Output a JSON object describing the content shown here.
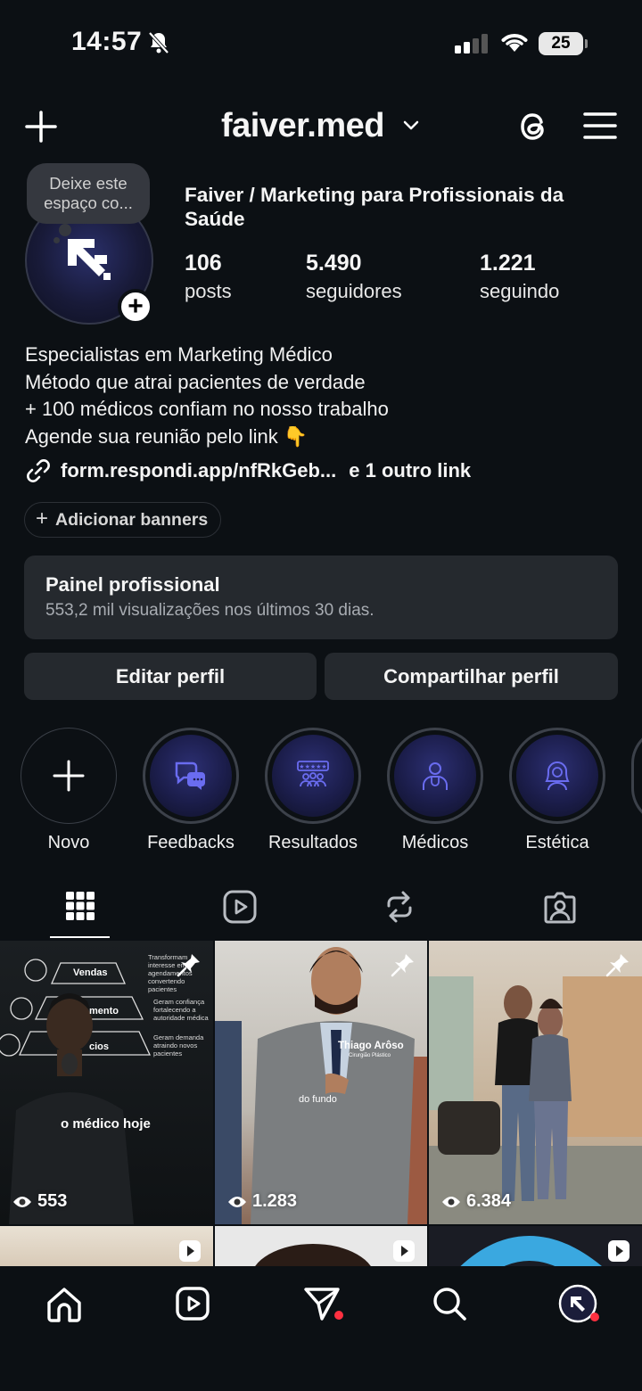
{
  "status_bar": {
    "time": "14:57",
    "battery": "25",
    "icons": [
      "bell-slash-icon",
      "signal-icon",
      "wifi-icon",
      "battery-icon"
    ]
  },
  "header": {
    "username": "faiver.med",
    "icons": [
      "plus-icon",
      "chevron-down-icon",
      "threads-icon",
      "menu-icon"
    ]
  },
  "profile": {
    "note": "Deixe este espaço co...",
    "full_name": "Faiver / Marketing para Profissionais da Saúde",
    "stats": [
      {
        "value": "106",
        "label": "posts"
      },
      {
        "value": "5.490",
        "label": "seguidores"
      },
      {
        "value": "1.221",
        "label": "seguindo"
      }
    ],
    "bio": [
      "Especialistas em Marketing Médico",
      "Método que atrai pacientes de verdade",
      "+ 100 médicos confiam no nosso trabalho",
      "Agende sua reunião pelo link 👇"
    ],
    "link": "form.respondi.app/nfRkGeb...",
    "more_links": "e 1 outro link"
  },
  "banners_label": "Adicionar banners",
  "dashboard": {
    "title": "Painel profissional",
    "subtitle": "553,2 mil visualizações nos últimos 30 dias."
  },
  "buttons": {
    "edit": "Editar perfil",
    "share": "Compartilhar perfil"
  },
  "highlights": [
    {
      "label": "Novo",
      "icon": "plus-icon"
    },
    {
      "label": "Feedbacks",
      "icon": "chat-bubbles-icon"
    },
    {
      "label": "Resultados",
      "icon": "rating-people-icon"
    },
    {
      "label": "Médicos",
      "icon": "doctor-icon"
    },
    {
      "label": "Estética",
      "icon": "woman-face-icon"
    }
  ],
  "tabs": [
    "grid-icon",
    "reels-icon",
    "reposts-icon",
    "tagged-icon"
  ],
  "posts": [
    {
      "views": "553",
      "caption": "o médico hoje",
      "pinned": true,
      "diagram": [
        "Vendas",
        "mento",
        "cios"
      ],
      "notes": [
        "Transformam interesse em agendamentos convertendo pacientes",
        "Geram confiança fortalecendo a autoridade médica",
        "Geram demanda atraindo novos pacientes"
      ]
    },
    {
      "views": "1.283",
      "pinned": true,
      "overlay_name": "Thiago Arôso",
      "overlay_sub": "Cirurgião Plástico",
      "overlay_caption": "do fundo"
    },
    {
      "views": "6.384",
      "pinned": true
    }
  ],
  "bottom_nav": [
    "home-icon",
    "reels-icon",
    "messages-icon",
    "search-icon",
    "profile-icon"
  ],
  "colors": {
    "background": "#0c1014",
    "surface": "#25292e",
    "notification": "#ff3040",
    "highlight_fill": "#1b1d4a",
    "highlight_icon": "#6a6cf0"
  }
}
